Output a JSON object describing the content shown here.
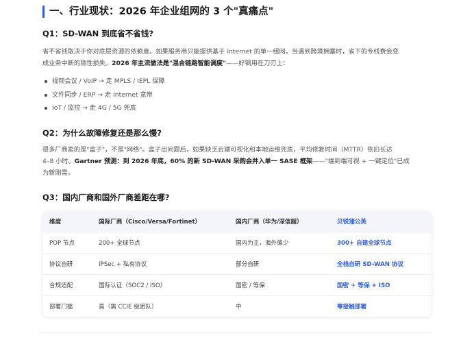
{
  "section_heading": "一、行业现状：2026 年企业组网的 3 个\"真痛点\"",
  "q1": {
    "title": "Q1：SD-WAN 到底省不省钱?",
    "para_lines": [
      "省不省钱取决于你对底层资源的依赖度。如果服务商只能提供基于 Internet 的单一组网，当遇到跨境拥塞时，省下的专线费会变",
      "成业务中断的隐性损失。"
    ],
    "para_bold": "2026 年主流做法是\"混合链路智能调度\"",
    "para_tail": "——好钢用在刀刃上：",
    "bullets": [
      "视频会议 / VoIP → 走 MPLS / IEPL 保障",
      "文件同步 / ERP → 走 Internet 宽带",
      "IoT / 监控 → 走 4G / 5G 兜底"
    ]
  },
  "q2": {
    "title": "Q2：为什么故障修复还是那么慢?",
    "para_line1": "很多厂商卖的是\"盒子\"，不是\"网络\"。盒子出问题后，如果缺乏云端可视化和本地运维兜底，平均修复时间（MTTR）依旧长达",
    "para_line2_pre": "4–8 小时。",
    "para_line2_bold": "Gartner 预测：到 2026 年底，60% 的新 SD-WAN 采购会并入单一 SASE 框架",
    "para_line2_tail": "——\"端到端可视 + 一键定位\"已成",
    "para_line3": "为新刚需。"
  },
  "q3": {
    "title": "Q3：国内厂商和国外厂商差距在哪?"
  },
  "table": {
    "headers": [
      "维度",
      "国际厂商（Cisco/Versa/Fortinet）",
      "国内厂商（华为/深信服）",
      "贝锐蒲公英"
    ],
    "rows": [
      [
        "POP 节点",
        "200+ 全球节点",
        "国内为主，海外偏少",
        "300+ 自建全球节点"
      ],
      [
        "协议自研",
        "IPSec + 私有协议",
        "部分自研",
        "全栈自研 SD-WAN 协议"
      ],
      [
        "合规适配",
        "国际认证（SOC2 / ISO）",
        "国密 / 等保",
        "国密 + 等保 + ISO"
      ],
      [
        "部署门槛",
        "高（需 CCIE 级团队）",
        "中",
        "零接触部署"
      ]
    ]
  },
  "colors": {
    "accent": "#2f5de0",
    "header_bg": "#f3f5fa",
    "body_text": "#555555"
  }
}
